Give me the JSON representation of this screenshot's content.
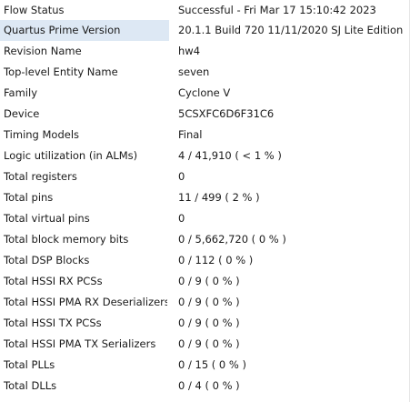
{
  "flow_summary": {
    "rows": [
      {
        "key": "Flow Status",
        "value": "Successful - Fri Mar 17 15:10:42 2023"
      },
      {
        "key": "Quartus Prime Version",
        "value": "20.1.1 Build 720 11/11/2020 SJ Lite Edition",
        "selected": true
      },
      {
        "key": "Revision Name",
        "value": "hw4"
      },
      {
        "key": "Top-level Entity Name",
        "value": "seven"
      },
      {
        "key": "Family",
        "value": "Cyclone V"
      },
      {
        "key": "Device",
        "value": "5CSXFC6D6F31C6"
      },
      {
        "key": "Timing Models",
        "value": "Final"
      },
      {
        "key": "Logic utilization (in ALMs)",
        "value": "4 / 41,910 ( < 1 % )"
      },
      {
        "key": "Total registers",
        "value": "0"
      },
      {
        "key": "Total pins",
        "value": "11 / 499 ( 2 % )"
      },
      {
        "key": "Total virtual pins",
        "value": "0"
      },
      {
        "key": "Total block memory bits",
        "value": "0 / 5,662,720 ( 0 % )"
      },
      {
        "key": "Total DSP Blocks",
        "value": "0 / 112 ( 0 % )"
      },
      {
        "key": "Total HSSI RX PCSs",
        "value": "0 / 9 ( 0 % )"
      },
      {
        "key": "Total HSSI PMA RX Deserializers",
        "value": "0 / 9 ( 0 % )"
      },
      {
        "key": "Total HSSI TX PCSs",
        "value": "0 / 9 ( 0 % )"
      },
      {
        "key": "Total HSSI PMA TX Serializers",
        "value": "0 / 9 ( 0 % )"
      },
      {
        "key": "Total PLLs",
        "value": "0 / 15 ( 0 % )"
      },
      {
        "key": "Total DLLs",
        "value": "0 / 4 ( 0 % )"
      }
    ]
  },
  "colors": {
    "selected_row": "#dde8f4",
    "text": "#1a1a1a",
    "background": "#ffffff"
  }
}
